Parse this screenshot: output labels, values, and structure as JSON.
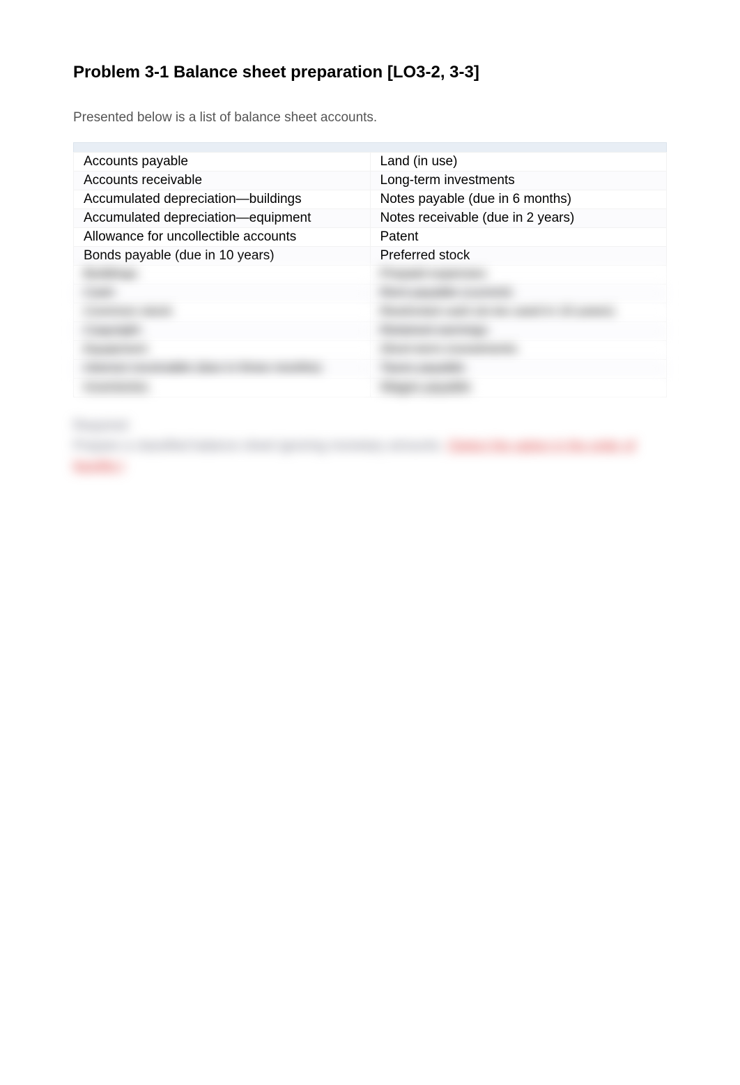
{
  "title": "Problem 3-1 Balance sheet preparation [LO3-2, 3-3]",
  "intro": "Presented below is a list of balance sheet accounts.",
  "accounts": {
    "rows": [
      {
        "left": "Accounts payable",
        "right": "Land (in use)"
      },
      {
        "left": "Accounts receivable",
        "right": "Long-term investments"
      },
      {
        "left": "Accumulated depreciation—buildings",
        "right": "Notes payable (due in 6 months)"
      },
      {
        "left": "Accumulated depreciation—equipment",
        "right": "Notes receivable (due in 2 years)"
      },
      {
        "left": "Allowance for uncollectible accounts",
        "right": "Patent"
      },
      {
        "left": "Bonds payable (due in 10 years)",
        "right": "Preferred stock"
      }
    ],
    "blurred_rows": [
      {
        "left": "Buildings",
        "right": "Prepaid expenses"
      },
      {
        "left": "Cash",
        "right": "Rent payable (current)"
      },
      {
        "left": "Common stock",
        "right": "Restricted cash (to be used in 10 years)"
      },
      {
        "left": "Copyright",
        "right": "Retained earnings"
      },
      {
        "left": "Equipment",
        "right": "Short-term investments"
      },
      {
        "left": "Interest receivable (due in three months)",
        "right": "Taxes payable"
      },
      {
        "left": "Inventories",
        "right": "Wages payable"
      }
    ]
  },
  "required": {
    "label": "Required:",
    "text_before": "Prepare a classified balance sheet ignoring monetary amounts.",
    "link_text": "(Select the option in the order of liquidity.)"
  }
}
